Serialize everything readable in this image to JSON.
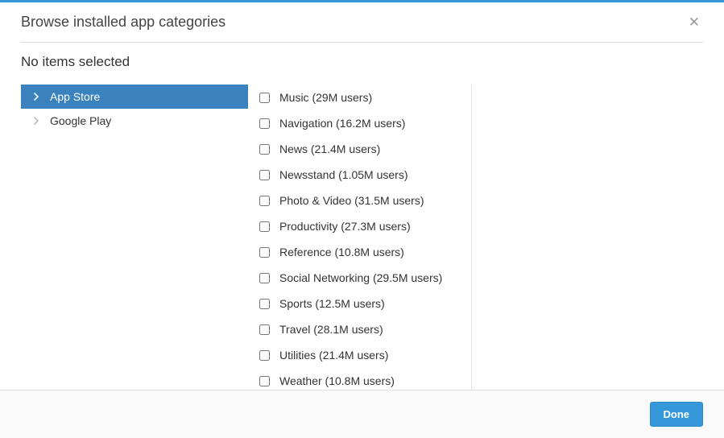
{
  "header": {
    "title": "Browse installed app categories"
  },
  "selection_status": "No items selected",
  "sources": [
    {
      "label": "App Store",
      "selected": true
    },
    {
      "label": "Google Play",
      "selected": false
    }
  ],
  "categories": [
    {
      "label": "Music (29M users)"
    },
    {
      "label": "Navigation (16.2M users)"
    },
    {
      "label": "News (21.4M users)"
    },
    {
      "label": "Newsstand (1.05M users)"
    },
    {
      "label": "Photo & Video (31.5M users)"
    },
    {
      "label": "Productivity (27.3M users)"
    },
    {
      "label": "Reference (10.8M users)"
    },
    {
      "label": "Social Networking (29.5M users)"
    },
    {
      "label": "Sports (12.5M users)"
    },
    {
      "label": "Travel (28.1M users)"
    },
    {
      "label": "Utilities (21.4M users)"
    },
    {
      "label": "Weather (10.8M users)"
    }
  ],
  "footer": {
    "done_label": "Done"
  }
}
